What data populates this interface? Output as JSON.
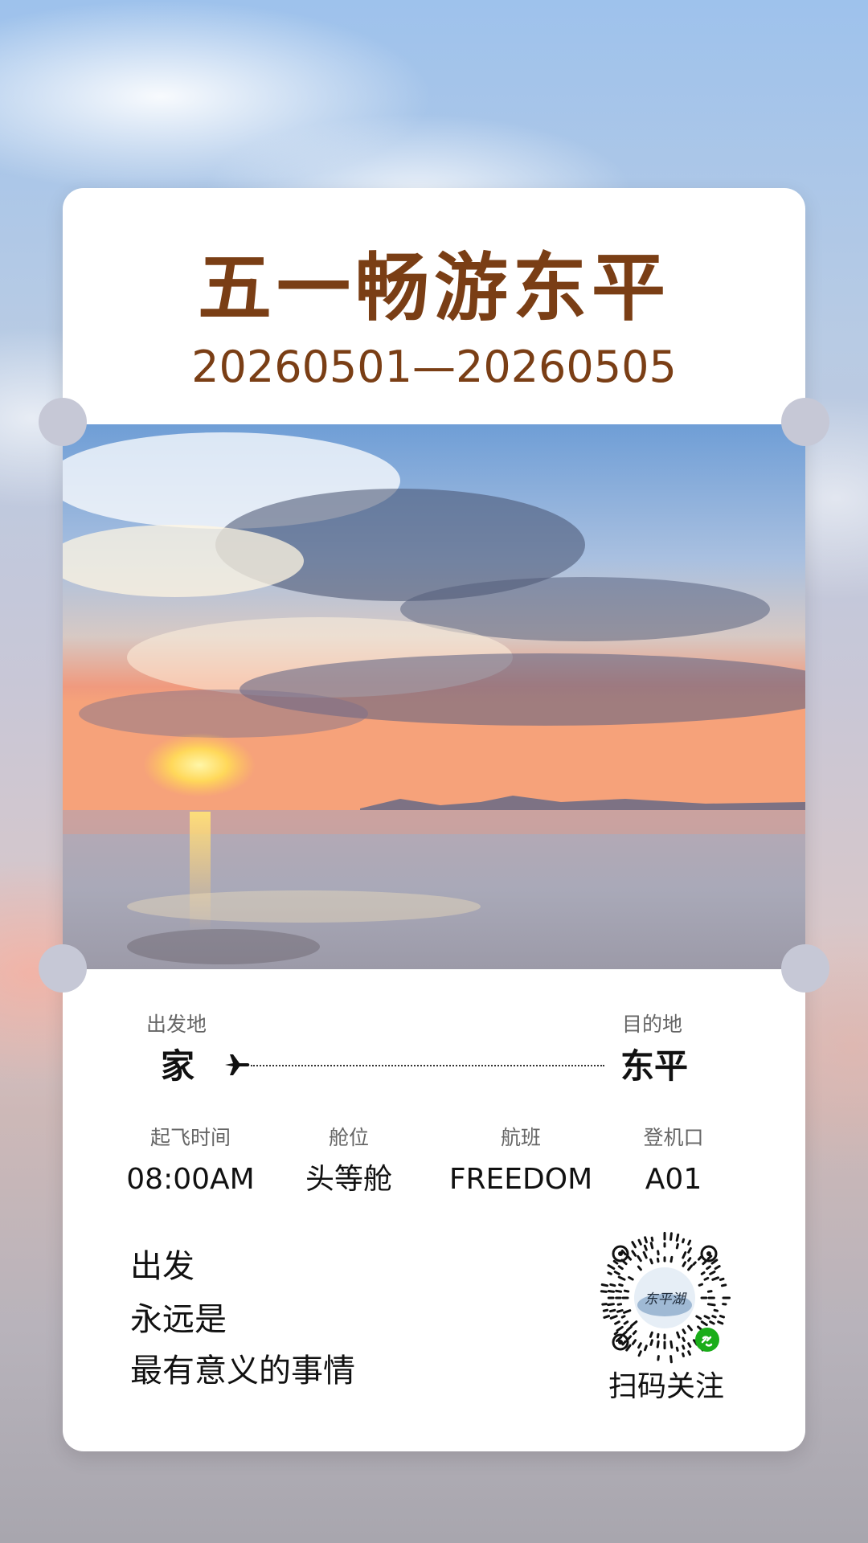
{
  "poster": {
    "title": "五一畅游东平",
    "date_range": "20260501—20260505"
  },
  "route": {
    "origin_label": "出发地",
    "origin": "家",
    "destination_label": "目的地",
    "destination": "东平"
  },
  "flight_info": {
    "time_label": "起飞时间",
    "time": "08:00AM",
    "class_label": "舱位",
    "class": "头等舱",
    "flight_label": "航班",
    "flight": "FREEDOM",
    "gate_label": "登机口",
    "gate": "A01"
  },
  "slogan": {
    "line1": "出发",
    "line2": "永远是",
    "line3": "最有意义的事情"
  },
  "qr": {
    "caption": "扫码关注",
    "logo_text": "东平湖"
  },
  "colors": {
    "title": "#7a3e15",
    "wechat_badge": "#1aad19"
  }
}
